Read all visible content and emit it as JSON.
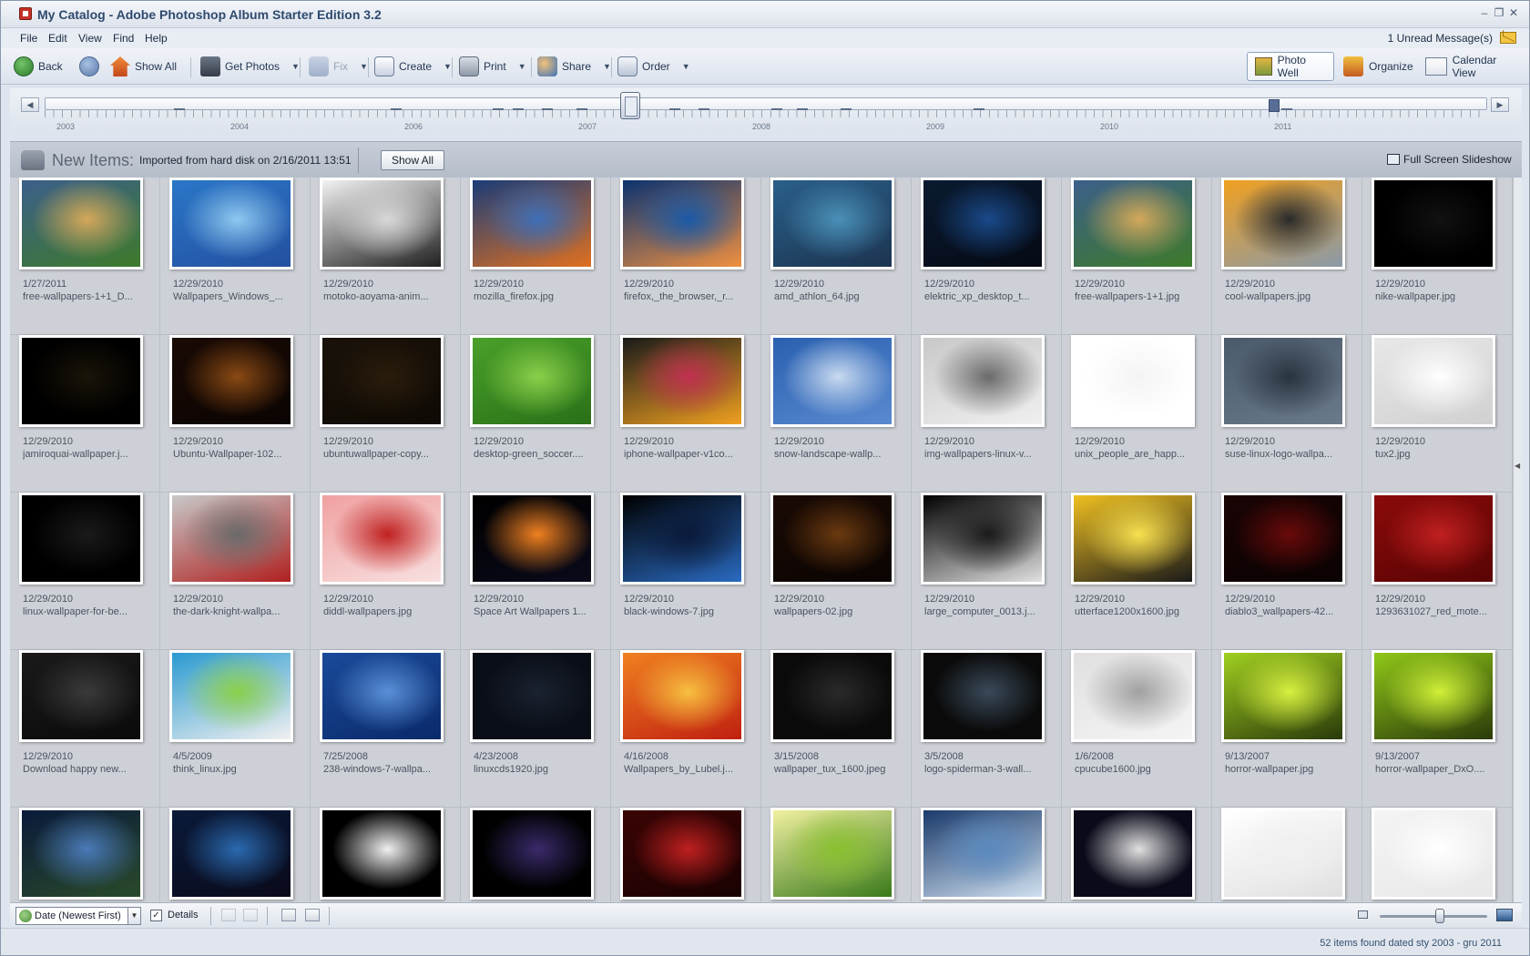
{
  "window": {
    "title": "My Catalog - Adobe Photoshop Album Starter Edition 3.2"
  },
  "menu": {
    "items": [
      "File",
      "Edit",
      "View",
      "Find",
      "Help"
    ],
    "message": "1 Unread Message(s)"
  },
  "toolbar": {
    "back": "Back",
    "show_all": "Show All",
    "get_photos": "Get Photos",
    "fix": "Fix",
    "create": "Create",
    "print": "Print",
    "share": "Share",
    "order": "Order",
    "views": {
      "photo_well": "Photo Well",
      "organize": "Organize",
      "calendar_view": "Calendar View"
    }
  },
  "timeline": {
    "years": [
      "2003",
      "2004",
      "2006",
      "2007",
      "2008",
      "2009",
      "2010",
      "2011"
    ]
  },
  "new_items": {
    "label": "New Items:",
    "text": "Imported from hard disk on 2/16/2011 13:51",
    "show_all": "Show All",
    "slideshow": "Full Screen Slideshow"
  },
  "photos": [
    {
      "date": "1/27/2011",
      "name": "free-wallpapers-1+1_D...",
      "colors": [
        "#3c5f8a",
        "#d4a85a",
        "#3d7a2a"
      ]
    },
    {
      "date": "12/29/2010",
      "name": "Wallpapers_Windows_...",
      "colors": [
        "#2a76c8",
        "#8ec8f0",
        "#2450a0"
      ]
    },
    {
      "date": "12/29/2010",
      "name": "motoko-aoyama-anim...",
      "colors": [
        "#f2f2f2",
        "#d8d8d8",
        "#202020"
      ]
    },
    {
      "date": "12/29/2010",
      "name": "mozilla_firefox.jpg",
      "colors": [
        "#1a3c78",
        "#3e6fb8",
        "#e07020"
      ]
    },
    {
      "date": "12/29/2010",
      "name": "firefox,_the_browser,_r...",
      "colors": [
        "#0a3270",
        "#1a5aa8",
        "#f09040"
      ]
    },
    {
      "date": "12/29/2010",
      "name": "amd_athlon_64.jpg",
      "colors": [
        "#2a5f8a",
        "#4a90b8",
        "#1c3450"
      ]
    },
    {
      "date": "12/29/2010",
      "name": "elektric_xp_desktop_t...",
      "colors": [
        "#0a1a30",
        "#1a4a8a",
        "#050a14"
      ]
    },
    {
      "date": "12/29/2010",
      "name": "free-wallpapers-1+1.jpg",
      "colors": [
        "#3c5f8a",
        "#d4a85a",
        "#3d7a2a"
      ]
    },
    {
      "date": "12/29/2010",
      "name": "cool-wallpapers.jpg",
      "colors": [
        "#f0a020",
        "#2a2a2a",
        "#8a9aa8"
      ]
    },
    {
      "date": "12/29/2010",
      "name": "nike-wallpaper.jpg",
      "colors": [
        "#000000",
        "#111111",
        "#000000"
      ]
    },
    {
      "date": "12/29/2010",
      "name": "jamiroquai-wallpaper.j...",
      "colors": [
        "#000000",
        "#1a1408",
        "#000000"
      ]
    },
    {
      "date": "12/29/2010",
      "name": "Ubuntu-Wallpaper-102...",
      "colors": [
        "#1a0a04",
        "#8a4a14",
        "#0a0402"
      ]
    },
    {
      "date": "12/29/2010",
      "name": "ubuntuwallpaper-copy...",
      "colors": [
        "#1a1208",
        "#2a1c0c",
        "#0e0a04"
      ]
    },
    {
      "date": "12/29/2010",
      "name": "desktop-green_soccer....",
      "colors": [
        "#4aa02a",
        "#8ad04a",
        "#2a7018"
      ]
    },
    {
      "date": "12/29/2010",
      "name": "iphone-wallpaper-v1co...",
      "colors": [
        "#1a1a1a",
        "#c03050",
        "#f0a020"
      ]
    },
    {
      "date": "12/29/2010",
      "name": "snow-landscape-wallp...",
      "colors": [
        "#2a60b0",
        "#c8daf0",
        "#5a8ad0"
      ]
    },
    {
      "date": "12/29/2010",
      "name": "img-wallpapers-linux-v...",
      "colors": [
        "#c8c8c8",
        "#6a6a6a",
        "#f0f0f0"
      ]
    },
    {
      "date": "12/29/2010",
      "name": "unix_people_are_happ...",
      "colors": [
        "#ffffff",
        "#f4f4f4",
        "#ffffff"
      ]
    },
    {
      "date": "12/29/2010",
      "name": "suse-linux-logo-wallpa...",
      "colors": [
        "#4a5a6a",
        "#2a3440",
        "#6a7a8a"
      ]
    },
    {
      "date": "12/29/2010",
      "name": "tux2.jpg",
      "colors": [
        "#e8e8e8",
        "#ffffff",
        "#d0d0d0"
      ]
    },
    {
      "date": "12/29/2010",
      "name": "linux-wallpaper-for-be...",
      "colors": [
        "#000000",
        "#1a1a1a",
        "#000000"
      ]
    },
    {
      "date": "12/29/2010",
      "name": "the-dark-knight-wallpa...",
      "colors": [
        "#c8c8c8",
        "#6a6a6a",
        "#b02020"
      ]
    },
    {
      "date": "12/29/2010",
      "name": "diddl-wallpapers.jpg",
      "colors": [
        "#f0a0a0",
        "#c02020",
        "#f8e0e0"
      ]
    },
    {
      "date": "12/29/2010",
      "name": "Space Art Wallpapers 1...",
      "colors": [
        "#000000",
        "#f08020",
        "#0a0a1a"
      ]
    },
    {
      "date": "12/29/2010",
      "name": "black-windows-7.jpg",
      "colors": [
        "#000000",
        "#0a1a3a",
        "#2a6ac0"
      ]
    },
    {
      "date": "12/29/2010",
      "name": "wallpapers-02.jpg",
      "colors": [
        "#1a0a04",
        "#6a3a10",
        "#0a0402"
      ]
    },
    {
      "date": "12/29/2010",
      "name": "large_computer_0013.j...",
      "colors": [
        "#000000",
        "#1a1a1a",
        "#e0e0e0"
      ]
    },
    {
      "date": "12/29/2010",
      "name": "utterface1200x1600.jpg",
      "colors": [
        "#f0c020",
        "#f8e050",
        "#1a1a1a"
      ]
    },
    {
      "date": "12/29/2010",
      "name": "diablo3_wallpapers-42...",
      "colors": [
        "#1a0404",
        "#6a0a0a",
        "#0a0202"
      ]
    },
    {
      "date": "12/29/2010",
      "name": "1293631027_red_mote...",
      "colors": [
        "#8a0a0a",
        "#c02020",
        "#5a0404"
      ]
    },
    {
      "date": "12/29/2010",
      "name": "Download happy new...",
      "colors": [
        "#1a1a1a",
        "#3a3a3a",
        "#0a0a0a"
      ]
    },
    {
      "date": "4/5/2009",
      "name": "think_linux.jpg",
      "colors": [
        "#2a9ad0",
        "#8ad04a",
        "#f0f0f0"
      ]
    },
    {
      "date": "7/25/2008",
      "name": "238-windows-7-wallpa...",
      "colors": [
        "#1a4a9a",
        "#5a90d8",
        "#0a2a6a"
      ]
    },
    {
      "date": "4/23/2008",
      "name": "linuxcds1920.jpg",
      "colors": [
        "#0a0e16",
        "#1a2230",
        "#0a0e16"
      ]
    },
    {
      "date": "4/16/2008",
      "name": "Wallpapers_by_Lubel.j...",
      "colors": [
        "#f08020",
        "#f8c040",
        "#c02010"
      ]
    },
    {
      "date": "3/15/2008",
      "name": "wallpaper_tux_1600.jpeg",
      "colors": [
        "#0a0a0a",
        "#2a2a2a",
        "#0a0a0a"
      ]
    },
    {
      "date": "3/5/2008",
      "name": "logo-spiderman-3-wall...",
      "colors": [
        "#0a0a0a",
        "#3a4a5a",
        "#0a0a0a"
      ]
    },
    {
      "date": "1/6/2008",
      "name": "cpucube1600.jpg",
      "colors": [
        "#e0e0e0",
        "#a0a0a0",
        "#f4f4f4"
      ]
    },
    {
      "date": "9/13/2007",
      "name": "horror-wallpaper.jpg",
      "colors": [
        "#a0d020",
        "#d8f040",
        "#2a3a0a"
      ]
    },
    {
      "date": "9/13/2007",
      "name": "horror-wallpaper_DxO....",
      "colors": [
        "#90c818",
        "#d0f038",
        "#2a3a0a"
      ]
    },
    {
      "date": "",
      "name": "",
      "colors": [
        "#0a1a3a",
        "#4a7ab8",
        "#2a4a2a"
      ]
    },
    {
      "date": "",
      "name": "",
      "colors": [
        "#0a1a3a",
        "#2a6ab0",
        "#0a0a1a"
      ]
    },
    {
      "date": "",
      "name": "",
      "colors": [
        "#000000",
        "#f0f0f0",
        "#000000"
      ]
    },
    {
      "date": "",
      "name": "",
      "colors": [
        "#000000",
        "#3a2a6a",
        "#000000"
      ]
    },
    {
      "date": "",
      "name": "",
      "colors": [
        "#3a0404",
        "#c02020",
        "#1a0202"
      ]
    },
    {
      "date": "",
      "name": "",
      "colors": [
        "#f0f0a0",
        "#8ac030",
        "#3a7a1a"
      ]
    },
    {
      "date": "",
      "name": "",
      "colors": [
        "#1a3a6a",
        "#5a8ac0",
        "#d0e0f0"
      ]
    },
    {
      "date": "",
      "name": "",
      "colors": [
        "#0a0a1a",
        "#e0e0e0",
        "#0a0a1a"
      ]
    },
    {
      "date": "",
      "name": "",
      "colors": [
        "#ffffff",
        "#f0f0f0",
        "#e0e0e0"
      ]
    },
    {
      "date": "",
      "name": "",
      "colors": [
        "#f4f4f4",
        "#ffffff",
        "#e8e8e8"
      ]
    }
  ],
  "bottom": {
    "sort": "Date (Newest First)",
    "details": "Details",
    "details_checked": "✓"
  },
  "status": {
    "text": "52 items found dated sty 2003 - gru 2011"
  }
}
